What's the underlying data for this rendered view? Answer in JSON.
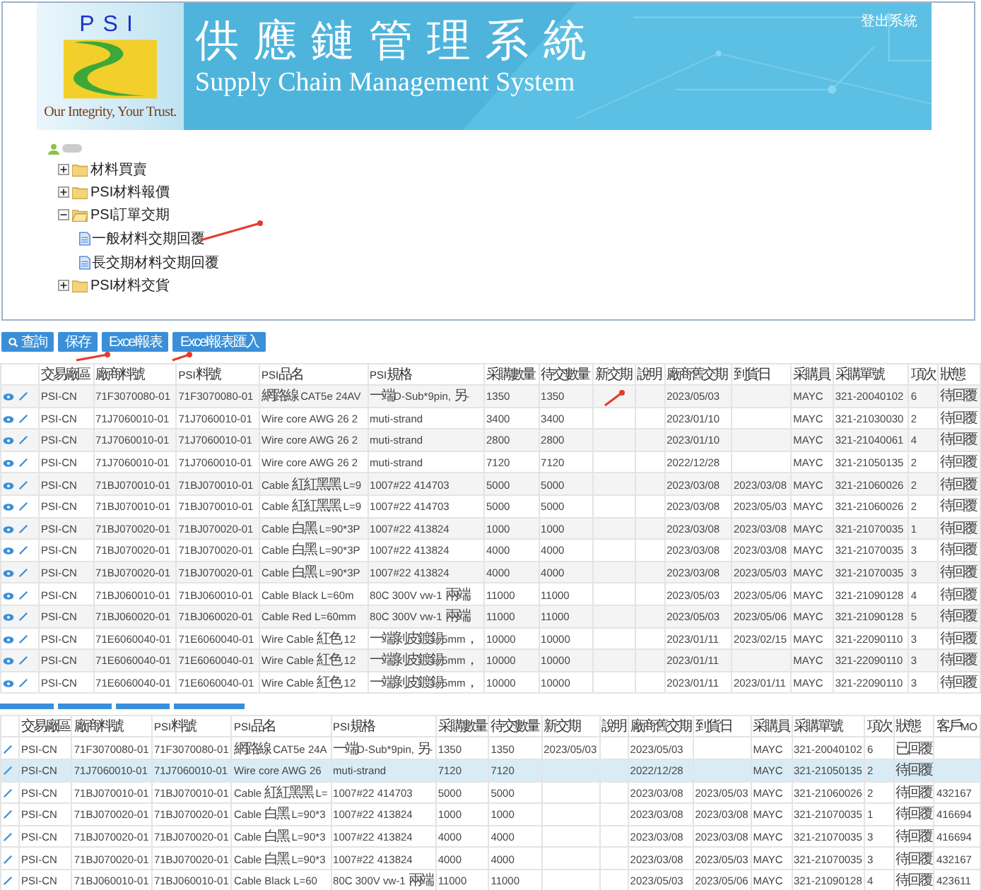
{
  "header": {
    "logo_text": "PSI",
    "slogan": "Our Integrity, Your Trust.",
    "title": "供應鏈管理系統",
    "subtitle": "Supply Chain Management System",
    "logout": "登出系統"
  },
  "tree": {
    "items": [
      {
        "label": "材料買賣",
        "expanded": false
      },
      {
        "label": "PSI材料報價",
        "expanded": false
      },
      {
        "label": "PSI訂單交期",
        "expanded": true,
        "children": [
          {
            "label": "一般材料交期回覆"
          },
          {
            "label": "長交期材料交期回覆"
          }
        ]
      },
      {
        "label": "PSI材料交貨",
        "expanded": false
      }
    ]
  },
  "toolbar": [
    {
      "label": "查詢",
      "kind": "search"
    },
    {
      "label": "保存",
      "kind": "plain"
    },
    {
      "label": "Excel報表",
      "kind": "plain"
    },
    {
      "label": "Excel報表匯入",
      "kind": "plain"
    }
  ],
  "top_table": {
    "columns": [
      "交易廠區",
      "廠商料號",
      "PSI料號",
      "PSI品名",
      "PSI規格",
      "采購數量",
      "待交數量",
      "新交期",
      "說明",
      "廠商舊交期",
      "到貨日",
      "采購員",
      "采購單號",
      "項次",
      "狀態"
    ],
    "rows": [
      [
        "PSI-CN",
        "71F3070080-01",
        "71F3070080-01",
        "網路線 CAT5e 24AV",
        "一端D-Sub*9pin, 另-",
        "1350",
        "1350",
        "",
        "",
        "2023/05/03",
        "",
        "MAYC",
        "321-20040102",
        "6",
        "待回覆"
      ],
      [
        "PSI-CN",
        "71J7060010-01",
        "71J7060010-01",
        "Wire core AWG 26 2",
        "muti-strand",
        "3400",
        "3400",
        "",
        "",
        "2023/01/10",
        "",
        "MAYC",
        "321-21030030",
        "2",
        "待回覆"
      ],
      [
        "PSI-CN",
        "71J7060010-01",
        "71J7060010-01",
        "Wire core AWG 26 2",
        "muti-strand",
        "2800",
        "2800",
        "",
        "",
        "2023/01/10",
        "",
        "MAYC",
        "321-21040061",
        "4",
        "待回覆"
      ],
      [
        "PSI-CN",
        "71J7060010-01",
        "71J7060010-01",
        "Wire core AWG 26 2",
        "muti-strand",
        "7120",
        "7120",
        "",
        "",
        "2022/12/28",
        "",
        "MAYC",
        "321-21050135",
        "2",
        "待回覆"
      ],
      [
        "PSI-CN",
        "71BJ070010-01",
        "71BJ070010-01",
        "Cable 紅紅黑黑 L=9",
        "1007#22 414703",
        "5000",
        "5000",
        "",
        "",
        "2023/03/08",
        "2023/03/08",
        "MAYC",
        "321-21060026",
        "2",
        "待回覆"
      ],
      [
        "PSI-CN",
        "71BJ070010-01",
        "71BJ070010-01",
        "Cable 紅紅黑黑 L=9",
        "1007#22 414703",
        "5000",
        "5000",
        "",
        "",
        "2023/03/08",
        "2023/05/03",
        "MAYC",
        "321-21060026",
        "2",
        "待回覆"
      ],
      [
        "PSI-CN",
        "71BJ070020-01",
        "71BJ070020-01",
        "Cable 白黑 L=90*3P",
        "1007#22 413824",
        "1000",
        "1000",
        "",
        "",
        "2023/03/08",
        "2023/03/08",
        "MAYC",
        "321-21070035",
        "1",
        "待回覆"
      ],
      [
        "PSI-CN",
        "71BJ070020-01",
        "71BJ070020-01",
        "Cable 白黑 L=90*3P",
        "1007#22 413824",
        "4000",
        "4000",
        "",
        "",
        "2023/03/08",
        "2023/03/08",
        "MAYC",
        "321-21070035",
        "3",
        "待回覆"
      ],
      [
        "PSI-CN",
        "71BJ070020-01",
        "71BJ070020-01",
        "Cable 白黑 L=90*3P",
        "1007#22 413824",
        "4000",
        "4000",
        "",
        "",
        "2023/03/08",
        "2023/05/03",
        "MAYC",
        "321-21070035",
        "3",
        "待回覆"
      ],
      [
        "PSI-CN",
        "71BJ060010-01",
        "71BJ060010-01",
        "Cable Black L=60m",
        "80C 300V vw-1 兩端",
        "11000",
        "11000",
        "",
        "",
        "2023/05/03",
        "2023/05/06",
        "MAYC",
        "321-21090128",
        "4",
        "待回覆"
      ],
      [
        "PSI-CN",
        "71BJ060020-01",
        "71BJ060020-01",
        "Cable Red L=60mm",
        "80C 300V vw-1 兩端",
        "11000",
        "11000",
        "",
        "",
        "2023/05/03",
        "2023/05/06",
        "MAYC",
        "321-21090128",
        "5",
        "待回覆"
      ],
      [
        "PSI-CN",
        "71E6060040-01",
        "71E6060040-01",
        "Wire Cable 紅色 12",
        "一端剝皮鍍錫5mm，",
        "10000",
        "10000",
        "",
        "",
        "2023/01/11",
        "2023/02/15",
        "MAYC",
        "321-22090110",
        "3",
        "待回覆"
      ],
      [
        "PSI-CN",
        "71E6060040-01",
        "71E6060040-01",
        "Wire Cable 紅色 12",
        "一端剝皮鍍錫5mm，",
        "10000",
        "10000",
        "",
        "",
        "2023/01/11",
        "",
        "MAYC",
        "321-22090110",
        "3",
        "待回覆"
      ],
      [
        "PSI-CN",
        "71E6060040-01",
        "71E6060040-01",
        "Wire Cable 紅色 12",
        "一端剝皮鍍錫5mm，",
        "10000",
        "10000",
        "",
        "",
        "2023/01/11",
        "2023/01/11",
        "MAYC",
        "321-22090110",
        "3",
        "待回覆"
      ]
    ]
  },
  "lower_toolbar": [
    {
      "kind": "button"
    },
    {
      "kind": "button"
    },
    {
      "kind": "button"
    },
    {
      "kind": "button"
    }
  ],
  "lower_table": {
    "columns": [
      "交易廠區",
      "廠商料號",
      "PSI料號",
      "PSI品名",
      "PSI規格",
      "采購數量",
      "待交數量",
      "新交期",
      "說明",
      "廠商舊交期",
      "到貨日",
      "采購員",
      "采購單號",
      "項次",
      "狀態",
      "客戶MO"
    ],
    "rows": [
      {
        "selected": false,
        "cells": [
          "PSI-CN",
          "71F3070080-01",
          "71F3070080-01",
          "網路線 CAT5e 24A",
          "一端D-Sub*9pin, 另-",
          "1350",
          "1350",
          "2023/05/03",
          "",
          "2023/05/03",
          "",
          "MAYC",
          "321-20040102",
          "6",
          "已回覆",
          ""
        ]
      },
      {
        "selected": true,
        "cells": [
          "PSI-CN",
          "71J7060010-01",
          "71J7060010-01",
          "Wire core AWG 26",
          "muti-strand",
          "7120",
          "7120",
          "",
          "",
          "2022/12/28",
          "",
          "MAYC",
          "321-21050135",
          "2",
          "待回覆",
          ""
        ]
      },
      {
        "selected": false,
        "cells": [
          "PSI-CN",
          "71BJ070010-01",
          "71BJ070010-01",
          "Cable 紅紅黑黑 L=",
          "1007#22 414703",
          "5000",
          "5000",
          "",
          "",
          "2023/03/08",
          "2023/05/03",
          "MAYC",
          "321-21060026",
          "2",
          "待回覆",
          "432167"
        ]
      },
      {
        "selected": false,
        "cells": [
          "PSI-CN",
          "71BJ070020-01",
          "71BJ070020-01",
          "Cable 白黑 L=90*3",
          "1007#22 413824",
          "1000",
          "1000",
          "",
          "",
          "2023/03/08",
          "2023/03/08",
          "MAYC",
          "321-21070035",
          "1",
          "待回覆",
          "416694"
        ]
      },
      {
        "selected": false,
        "cells": [
          "PSI-CN",
          "71BJ070020-01",
          "71BJ070020-01",
          "Cable 白黑 L=90*3",
          "1007#22 413824",
          "4000",
          "4000",
          "",
          "",
          "2023/03/08",
          "2023/03/08",
          "MAYC",
          "321-21070035",
          "3",
          "待回覆",
          "416694"
        ]
      },
      {
        "selected": false,
        "cells": [
          "PSI-CN",
          "71BJ070020-01",
          "71BJ070020-01",
          "Cable 白黑 L=90*3",
          "1007#22 413824",
          "4000",
          "4000",
          "",
          "",
          "2023/03/08",
          "2023/05/03",
          "MAYC",
          "321-21070035",
          "3",
          "待回覆",
          "432167"
        ]
      },
      {
        "selected": false,
        "cells": [
          "PSI-CN",
          "71BJ060010-01",
          "71BJ060010-01",
          "Cable Black L=60",
          "80C 300V vw-1 兩端",
          "11000",
          "11000",
          "",
          "",
          "2023/05/03",
          "2023/05/06",
          "MAYC",
          "321-21090128",
          "4",
          "待回覆",
          "423611"
        ]
      }
    ]
  }
}
